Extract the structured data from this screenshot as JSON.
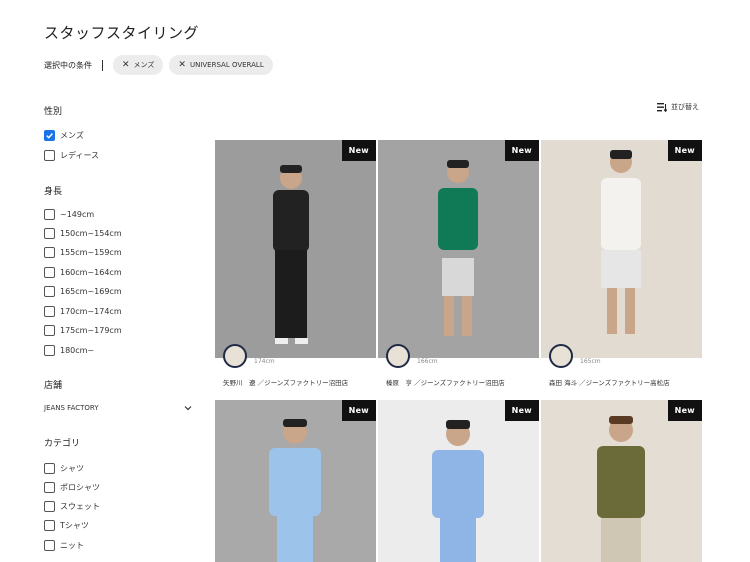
{
  "page": {
    "title": "スタッフスタイリング"
  },
  "filters": {
    "label": "選択中の条件",
    "chips": [
      {
        "label": "メンズ"
      },
      {
        "label": "UNIVERSAL OVERALL"
      }
    ]
  },
  "sort": {
    "label": "並び替え"
  },
  "sidebar": {
    "gender": {
      "heading": "性別",
      "options": [
        {
          "label": "メンズ",
          "checked": true
        },
        {
          "label": "レディース",
          "checked": false
        }
      ]
    },
    "height": {
      "heading": "身長",
      "options": [
        {
          "label": "~149cm"
        },
        {
          "label": "150cm~154cm"
        },
        {
          "label": "155cm~159cm"
        },
        {
          "label": "160cm~164cm"
        },
        {
          "label": "165cm~169cm"
        },
        {
          "label": "170cm~174cm"
        },
        {
          "label": "175cm~179cm"
        },
        {
          "label": "180cm~"
        }
      ]
    },
    "store": {
      "heading": "店舗",
      "selected": "JEANS FACTORY"
    },
    "category": {
      "heading": "カテゴリ",
      "options": [
        {
          "label": "シャツ"
        },
        {
          "label": "ポロシャツ"
        },
        {
          "label": "スウェット"
        },
        {
          "label": "Tシャツ"
        },
        {
          "label": "ニット"
        }
      ]
    }
  },
  "cards": [
    {
      "badge": "New",
      "height": "174cm",
      "staff": "矢野川　遼 ／ジーンズファクトリー沼田店",
      "bg": "#9c9c9c",
      "top": "#222222",
      "bottom": "#1c1c1c"
    },
    {
      "badge": "New",
      "height": "166cm",
      "staff": "榛原　亨 ／ジーンズファクトリー沼田店",
      "bg": "#a3a3a3",
      "top": "#0f7a55",
      "bottom": "#d8d8d8"
    },
    {
      "badge": "New",
      "height": "165cm",
      "staff": "森田 海斗 ／ジーンズファクトリー高松店",
      "bg": "#e2dbd2",
      "top": "#f4f2ee",
      "bottom": "#e6e6e6"
    },
    {
      "badge": "New",
      "bg": "#a9a9a9",
      "top": "#9cc3ea",
      "bottom": "#9cc3ea"
    },
    {
      "badge": "New",
      "bg": "#ececec",
      "top": "#8fb4e6",
      "bottom": "#8fb4e6"
    },
    {
      "badge": "New",
      "bg": "#e4ddd4",
      "top": "#6b6b3a",
      "bottom": "#cfc7b4"
    }
  ]
}
